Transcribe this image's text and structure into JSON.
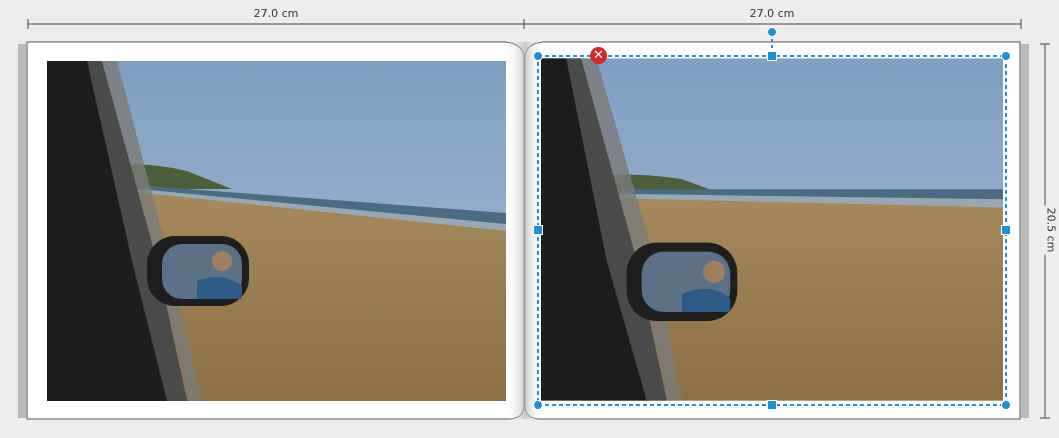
{
  "rulers": {
    "left_page_width": "27.0 cm",
    "right_page_width": "27.0 cm",
    "page_height": "20.5 cm"
  },
  "spread": {
    "left_page": {
      "photo": "beach-drive-mirror-photo"
    },
    "right_page": {
      "photo": "beach-drive-mirror-photo",
      "selected": true
    }
  },
  "icons": {
    "delete": "delete-icon"
  },
  "colors": {
    "selection": "#1e90d6",
    "delete": "#d7262b",
    "background": "#ededed"
  }
}
